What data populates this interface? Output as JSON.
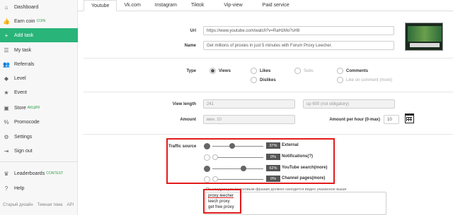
{
  "sidebar": {
    "items": [
      {
        "label": "Dashboard",
        "icon": "home-icon",
        "sup": ""
      },
      {
        "label": "Earn coin",
        "icon": "coin-icon",
        "sup": "COIN"
      },
      {
        "label": "Add task",
        "icon": "plus-icon",
        "sup": ""
      },
      {
        "label": "My task",
        "icon": "list-icon",
        "sup": ""
      },
      {
        "label": "Referrals",
        "icon": "users-icon",
        "sup": ""
      },
      {
        "label": "Level",
        "icon": "level-icon",
        "sup": ""
      },
      {
        "label": "Event",
        "icon": "event-icon",
        "sup": ""
      },
      {
        "label": "Store",
        "icon": "store-icon",
        "sup": "АКЦИЯ"
      },
      {
        "label": "Promocode",
        "icon": "promo-icon",
        "sup": ""
      },
      {
        "label": "Settings",
        "icon": "gear-icon",
        "sup": ""
      },
      {
        "label": "Sign out",
        "icon": "signout-icon",
        "sup": ""
      },
      {
        "label": "Leaderboards",
        "icon": "trophy-icon",
        "sup": "CONTEST"
      },
      {
        "label": "Help",
        "icon": "help-icon",
        "sup": ""
      }
    ],
    "footer": [
      "Старый дизайн",
      "Темная тема",
      "API"
    ],
    "active_color": "#29b47a"
  },
  "tabs": [
    "Youtube",
    "Vk.com",
    "Instagram",
    "Tiktok",
    "Vip-view",
    "Paid service"
  ],
  "form": {
    "url_label": "Url",
    "url_value": "https://www.youtube.com/watch?v=RaHzMo?sH8",
    "name_label": "Name",
    "name_value": "Get millions of proxies in just 5 minutes with Forum Proxy Leecher.",
    "type_label": "Type",
    "types": {
      "views": "Views",
      "likes": "Likes",
      "subs": "Subs",
      "comments": "Comments",
      "dislikes": "Dislikes",
      "like_on_comment": "Like on comment (more)"
    },
    "view_length_label": "View length",
    "view_length_value": "241",
    "view_length_hint": "up 600 (not obligatory)",
    "amount_label": "Amount",
    "amount_placeholder": "мин. 10",
    "amount_per_hour_label": "Amount per hour (0-max)",
    "amount_per_hour_value": "10"
  },
  "traffic": {
    "label": "Traffic source",
    "sources": [
      {
        "name": "External",
        "percent": "37%",
        "enabled": true,
        "level": 0.37
      },
      {
        "name": "Notifications(?)",
        "percent": "0%",
        "enabled": false,
        "level": 0
      },
      {
        "name": "YouTube search(more)",
        "percent": "62%",
        "enabled": true,
        "level": 0.62
      },
      {
        "name": "Channel pages(more)",
        "percent": "0%",
        "enabled": false,
        "level": 0
      }
    ]
  },
  "keywords": {
    "title": "По следующим поисковым фразам должно находится видео указанное выше",
    "lines": [
      "proxy leecher",
      "leech proxy",
      "get free proxy"
    ]
  },
  "colors": {
    "highlight": "#e31b1b"
  }
}
